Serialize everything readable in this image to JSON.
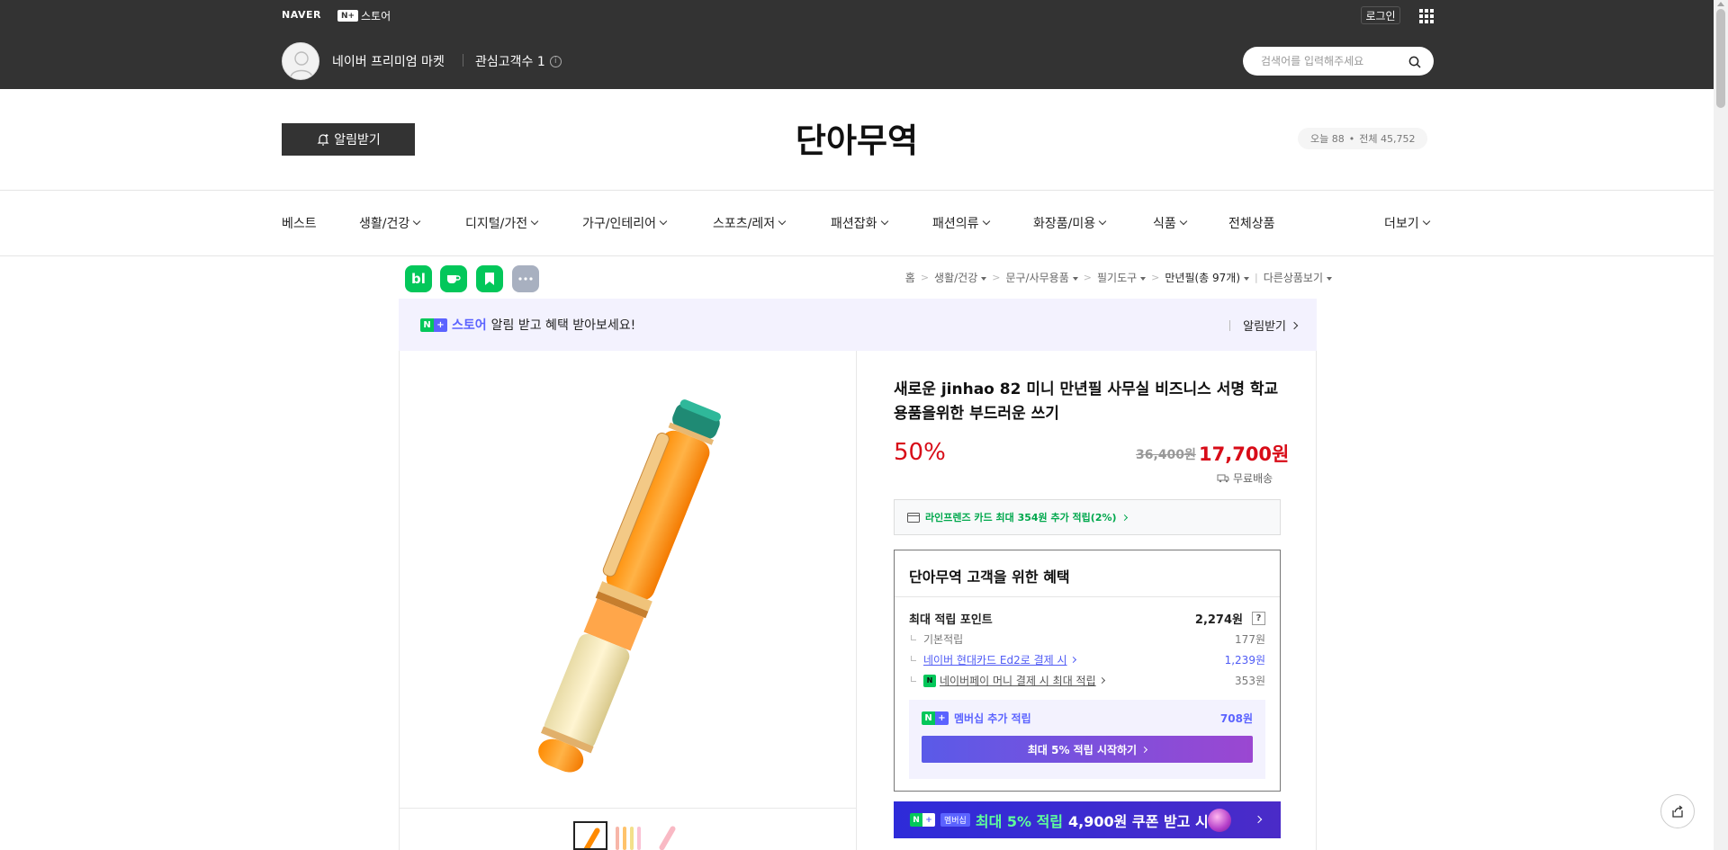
{
  "gnb": {
    "naver_logo": "NAVER",
    "np_badge": "N+",
    "store_label": "스토어",
    "login": "로그인"
  },
  "profile": {
    "store_name": "네이버 프리미엄 마켓",
    "interest_label": "관심고객수 1"
  },
  "search": {
    "placeholder": "검색어를 입력해주세요"
  },
  "header": {
    "alarm_button": "알림받기",
    "store_title": "단아무역",
    "visit_today": "오늘 88",
    "visit_dot": "•",
    "visit_total": "전체 45,752"
  },
  "categories": [
    {
      "label": "베스트",
      "dropdown": false
    },
    {
      "label": "생활/건강",
      "dropdown": true
    },
    {
      "label": "디지털/가전",
      "dropdown": true
    },
    {
      "label": "가구/인테리어",
      "dropdown": true
    },
    {
      "label": "스포츠/레저",
      "dropdown": true
    },
    {
      "label": "패션잡화",
      "dropdown": true
    },
    {
      "label": "패션의류",
      "dropdown": true
    },
    {
      "label": "화장품/미용",
      "dropdown": true
    },
    {
      "label": "식품",
      "dropdown": true
    },
    {
      "label": "전체상품",
      "dropdown": false
    }
  ],
  "more_label": "더보기",
  "actions": {
    "blog_icon": "bl",
    "colors": {
      "green": "#03c75a",
      "gray": "#a8b0c0"
    }
  },
  "breadcrumb": {
    "home": "홈",
    "sep": ">",
    "c1": "생활/건강",
    "c2": "문구/사무용품",
    "c3": "필기도구",
    "c4": "만년필(총 97개)",
    "other": "다른상품보기"
  },
  "notify": {
    "np_n": "N",
    "np_plus": "+",
    "store_word": "스토어",
    "text": "알림 받고 혜택 받아보세요!",
    "button": "알림받기"
  },
  "product": {
    "title": "새로운 jinhao 82 미니 만년필 사무실 비즈니스 서명 학교 용품을위한 부드러운 쓰기",
    "discount": "50%",
    "original_price": "36,400원",
    "sale_price": "17,700원",
    "shipping": "무료배송",
    "card_benefit": "라인프렌즈 카드 최대 354원 추가 적립(2%)"
  },
  "benefit": {
    "title": "단아무역 고객을 위한 혜택",
    "max_point_label": "최대 적립 포인트",
    "max_point_value": "2,274원",
    "q_icon": "?",
    "basic_label": "기본적립",
    "basic_value": "177원",
    "card_label": "네이버 현대카드 Ed2로 결제 시",
    "card_value": "1,239원",
    "npay_icon": "N",
    "npay_label": "네이버페이 머니 결제 시 최대 적립",
    "npay_value": "353원",
    "member_label": "멤버십 추가 적립",
    "member_value": "708원",
    "start_button": "최대 5% 적립 시작하기"
  },
  "promo": {
    "np_n": "N",
    "np_plus": "+",
    "tag": "멤버십",
    "highlight": "최대 5% 적립",
    "text": "4,900원 쿠폰 받고 시작"
  },
  "colors": {
    "dark": "#333333",
    "price_red": "#d80c18",
    "naver_green": "#03c75a",
    "np_purple": "#5b63ff"
  }
}
